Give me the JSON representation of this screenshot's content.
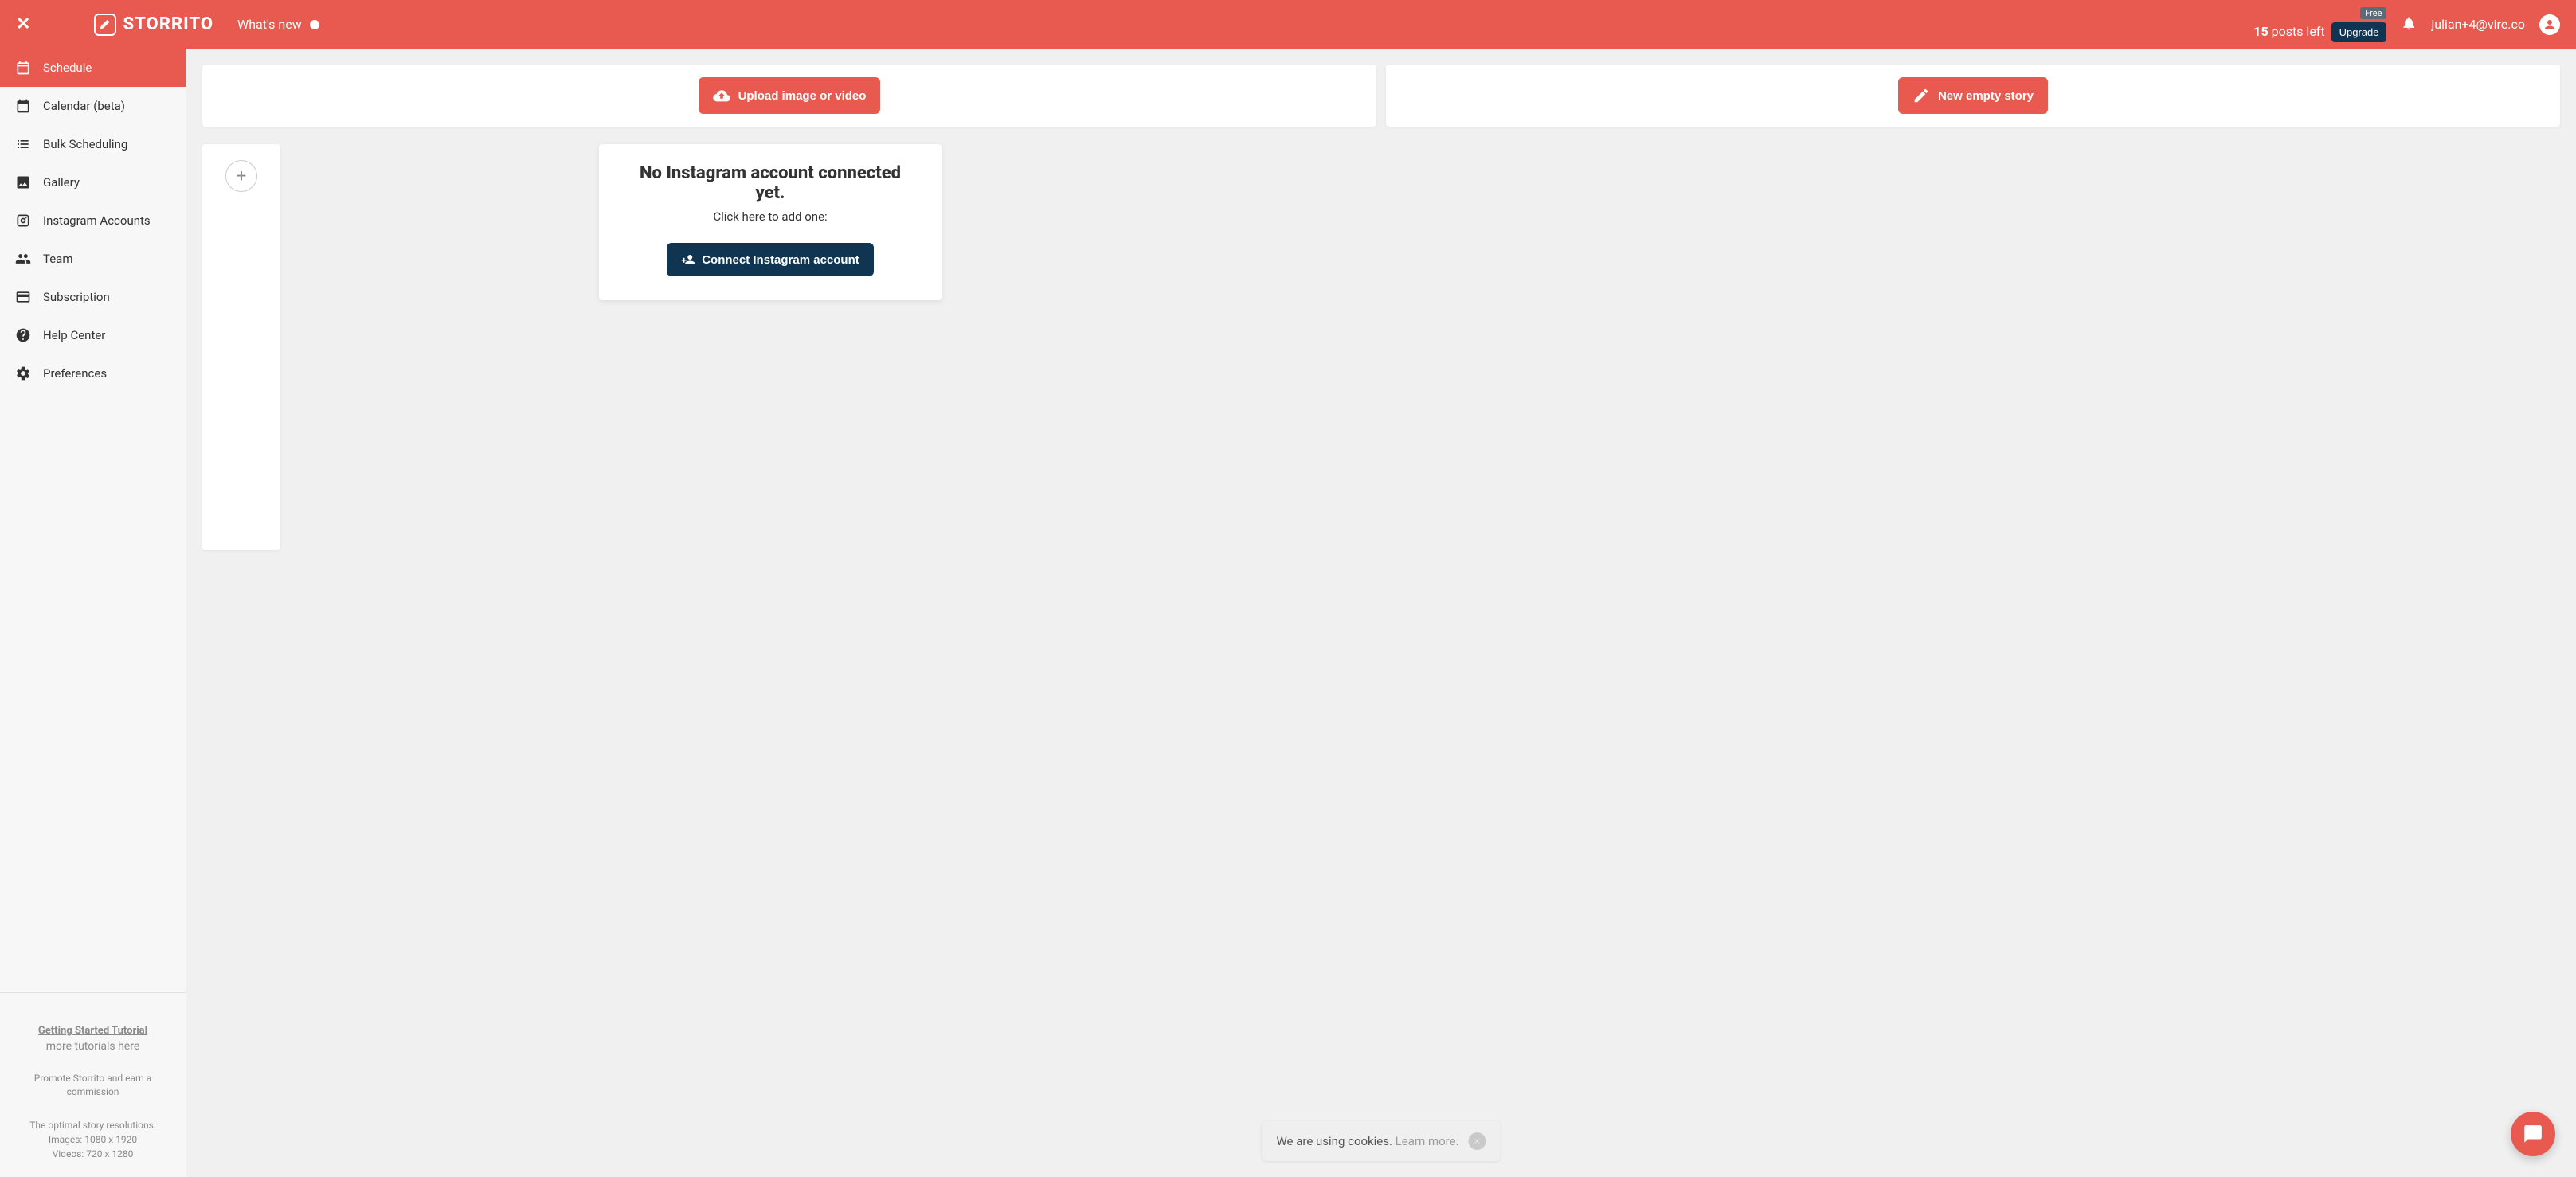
{
  "topbar": {
    "brand": "STORRITO",
    "whats_new": "What's new",
    "plan_badge": "Free",
    "posts_count": "15",
    "posts_label": " posts left",
    "upgrade": "Upgrade",
    "user_email": "julian+4@vire.co"
  },
  "sidebar": {
    "items": [
      {
        "label": "Schedule",
        "active": true
      },
      {
        "label": "Calendar (beta)",
        "active": false
      },
      {
        "label": "Bulk Scheduling",
        "active": false
      },
      {
        "label": "Gallery",
        "active": false
      },
      {
        "label": "Instagram Accounts",
        "active": false
      },
      {
        "label": "Team",
        "active": false
      },
      {
        "label": "Subscription",
        "active": false
      },
      {
        "label": "Help Center",
        "active": false
      },
      {
        "label": "Preferences",
        "active": false
      }
    ],
    "footer": {
      "tutorial_link": "Getting Started Tutorial",
      "more_tutorials": "more tutorials here",
      "promo": "Promote Storrito and earn a commission",
      "res_header": "The optimal story resolutions:",
      "res_images": "Images: 1080 x 1920",
      "res_videos": "Videos: 720 x 1280"
    }
  },
  "actions": {
    "upload": "Upload image or video",
    "new_story": "New empty story"
  },
  "connect": {
    "title": "No Instagram account connected yet.",
    "subtitle": "Click here to add one:",
    "button": "Connect Instagram account"
  },
  "cookie": {
    "text": "We are using cookies. ",
    "learn": "Learn more."
  }
}
